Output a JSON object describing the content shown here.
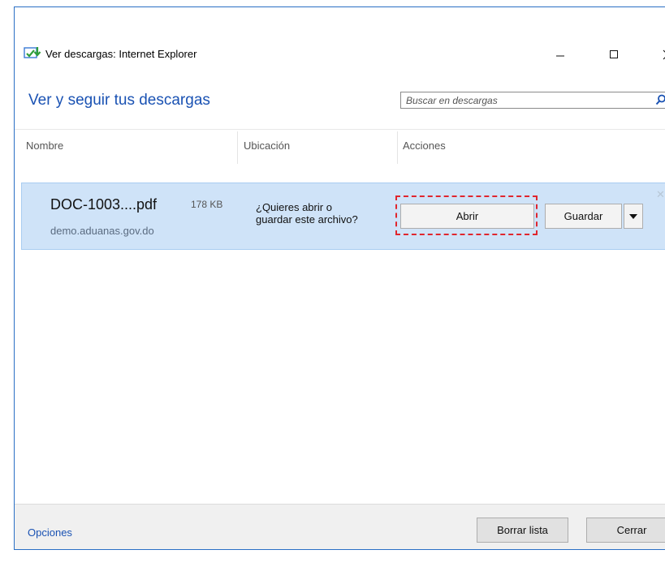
{
  "window": {
    "title": "Ver descargas: Internet Explorer",
    "controls": {
      "minimize": "–",
      "maximize": "☐",
      "close": "✕"
    },
    "icon": "download-app-icon",
    "accent": "#2a6fc5"
  },
  "heading": "Ver y seguir tus descargas",
  "search": {
    "placeholder": "Buscar en descargas",
    "icon": "search-icon"
  },
  "columns": {
    "name": "Nombre",
    "location": "Ubicación",
    "actions": "Acciones"
  },
  "download": {
    "file_name": "DOC-1003....pdf",
    "size": "178 KB",
    "source": "demo.aduanas.gov.do",
    "question_line1": "¿Quieres abrir o",
    "question_line2": "guardar este archivo?",
    "open_label": "Abrir",
    "save_label": "Guardar",
    "dismiss": "✕",
    "row_color": "#cfe3f8"
  },
  "footer": {
    "options": "Opciones",
    "clear_list": "Borrar lista",
    "close": "Cerrar"
  }
}
